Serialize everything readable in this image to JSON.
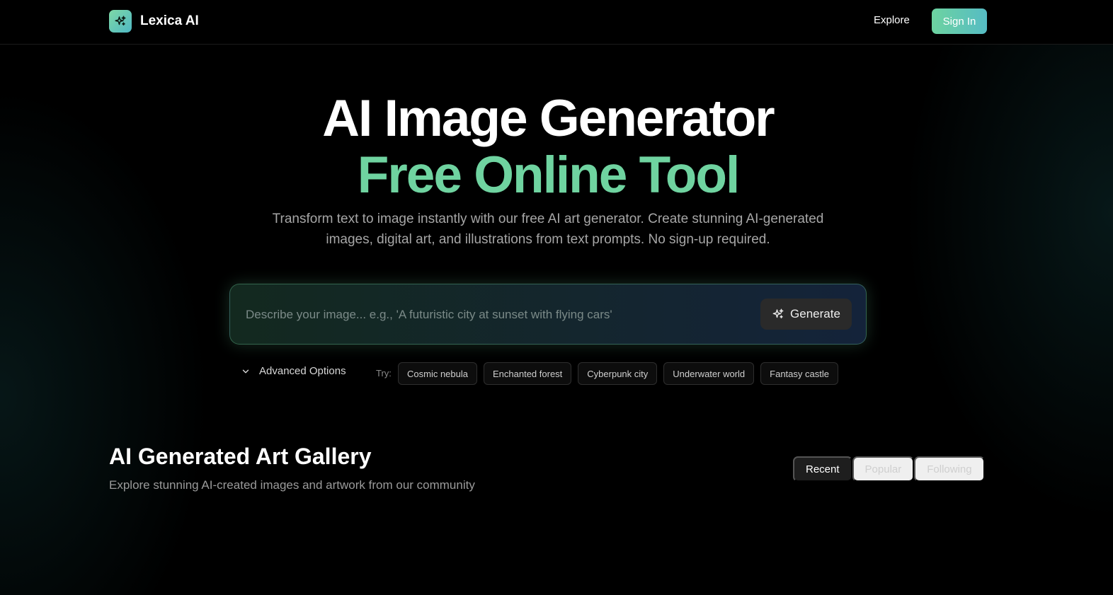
{
  "header": {
    "brand_name": "Lexica AI",
    "explore_label": "Explore",
    "signin_label": "Sign In"
  },
  "hero": {
    "title_line1": "AI Image Generator",
    "title_line2": "Free Online Tool",
    "subtitle": "Transform text to image instantly with our free AI art generator. Create stunning AI-generated images, digital art, and illustrations from text prompts. No sign-up required."
  },
  "prompt": {
    "placeholder": "Describe your image... e.g., 'A futuristic city at sunset with flying cars'",
    "value": "",
    "generate_label": "Generate"
  },
  "options": {
    "advanced_label": "Advanced Options",
    "try_label": "Try:",
    "suggestions": [
      "Cosmic nebula",
      "Enchanted forest",
      "Cyberpunk city",
      "Underwater world",
      "Fantasy castle"
    ]
  },
  "gallery": {
    "title": "AI Generated Art Gallery",
    "subtitle": "Explore stunning AI-created images and artwork from our community",
    "tabs": [
      {
        "label": "Recent",
        "active": true
      },
      {
        "label": "Popular",
        "active": false
      },
      {
        "label": "Following",
        "active": false
      }
    ]
  },
  "icons": {
    "logo": "sparkles-icon",
    "generate": "sparkles-icon",
    "advanced": "chevron-down-icon"
  },
  "colors": {
    "accent": "#6fd3a0",
    "accent_teal": "#56bcc4",
    "background": "#000000"
  }
}
